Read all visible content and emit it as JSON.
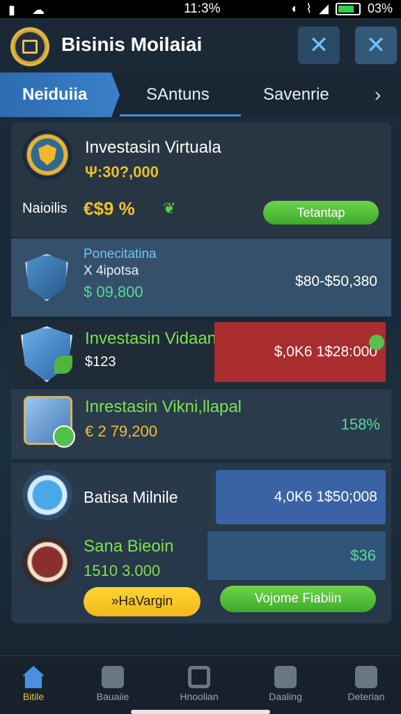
{
  "status": {
    "time": "11:3%",
    "battery": "03%"
  },
  "header": {
    "title": "Bisinis Moilaiai"
  },
  "tabs": [
    {
      "label": "Neiduiia"
    },
    {
      "label": "SAntuns"
    },
    {
      "label": "Savenrie"
    }
  ],
  "cards": {
    "c1": {
      "title": "Investasin Virtuala",
      "amount": "Ψ:30?,000",
      "label": "Naioilis",
      "pct": "€$9 %",
      "button": "Tetantap"
    },
    "c2": {
      "title": "Ponecitatina",
      "sub": "X 4ipotsa",
      "amount": "$ 09,800",
      "range": "$80-$50,380"
    },
    "c3": {
      "title": "Investasin Vidaania",
      "amount": "$123",
      "value": "$,0K6 1$28:000"
    },
    "c4": {
      "title": "Inrestasin Vikni,llapal",
      "amount": "€ 2 79,200",
      "pct": "158%"
    },
    "c5": {
      "title": "Batisa Milnile",
      "value": "4,0K6 1$50;008"
    },
    "c6": {
      "title": "Sana Bieoin",
      "amount": "1510 3.000",
      "value": "$36",
      "button1": "»HaVargin",
      "button2": "Vojome Fiabiin"
    }
  },
  "nav": [
    {
      "label": "Bitile",
      "icon": "home-icon"
    },
    {
      "label": "Bauaiie",
      "icon": "gear-icon"
    },
    {
      "label": "Hnoolian",
      "icon": "search-icon"
    },
    {
      "label": "Daaling",
      "icon": "box-icon"
    },
    {
      "label": "Deterian",
      "icon": "chart-icon"
    }
  ],
  "colors": {
    "accent": "#3a7fc6",
    "green": "#5fcf4a",
    "gold": "#f0c12a",
    "red": "#a92d2f"
  }
}
